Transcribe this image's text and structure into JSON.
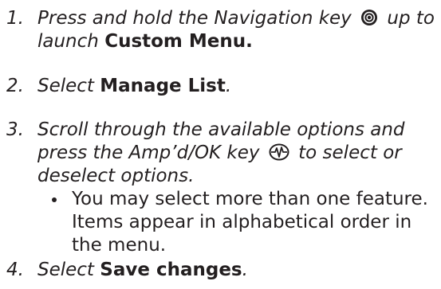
{
  "steps": [
    {
      "number": "1.",
      "line1_pre": "Press and hold the Navigation key",
      "line1_post": "up to",
      "line2_pre": "launch ",
      "line2_bold": "Custom Menu."
    },
    {
      "number": "2.",
      "pre": "Select ",
      "bold": "Manage List",
      "post": "."
    },
    {
      "number": "3.",
      "line1": "Scroll through the available options and",
      "line2_pre": "press the Amp’d/OK key",
      "line2_post": "to select or",
      "line3": "deselect options."
    },
    {
      "number": "4.",
      "pre": "Select ",
      "bold": "Save changes",
      "post": "."
    }
  ],
  "bullet": {
    "line1": "You may select more than one feature.",
    "line2": "Items appear in alphabetical order in",
    "line3": "the menu."
  },
  "icons": {
    "navigation_key": "navigation-key-icon",
    "ampd_ok_key": "ampd-ok-key-icon"
  }
}
